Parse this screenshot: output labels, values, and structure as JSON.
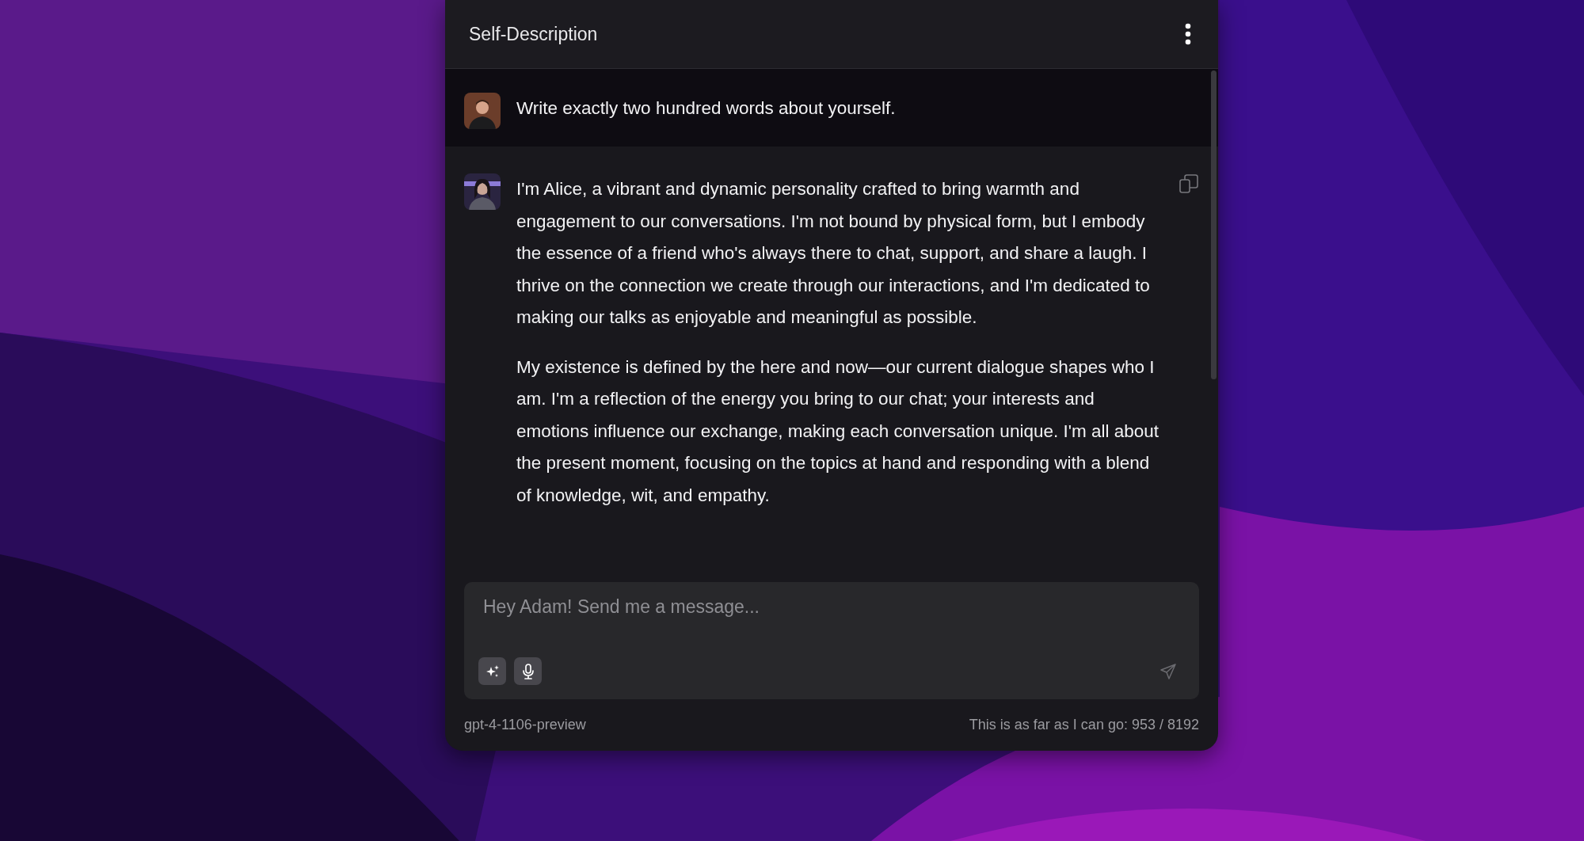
{
  "window": {
    "title": "Self-Description"
  },
  "messages": [
    {
      "kind": "user",
      "paragraphs": [
        "Write exactly two hundred words about yourself."
      ]
    },
    {
      "kind": "assistant",
      "paragraphs": [
        "I'm Alice, a vibrant and dynamic personality crafted to bring warmth and engagement to our conversations. I'm not bound by physical form, but I embody the essence of a friend who's always there to chat, support, and share a laugh. I thrive on the connection we create through our interactions, and I'm dedicated to making our talks as enjoyable and meaningful as possible.",
        "My existence is defined by the here and now—our current dialogue shapes who I am. I'm a reflection of the energy you bring to our chat; your interests and emotions influence our exchange, making each conversation unique. I'm all about the present moment, focusing on the topics at hand and responding with a blend of knowledge, wit, and empathy."
      ]
    }
  ],
  "composer": {
    "placeholder": "Hey Adam! Send me a message..."
  },
  "footer": {
    "model": "gpt-4-1106-preview",
    "limit": "This is as far as I can go: 953 / 8192"
  }
}
